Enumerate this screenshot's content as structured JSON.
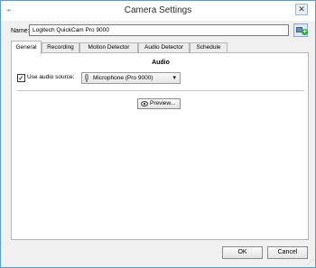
{
  "window": {
    "title": "Camera Settings",
    "close_glyph": "✕",
    "icon": "camera-icon"
  },
  "name_row": {
    "label": "Name:",
    "value": "Logitech QuickCam Pro 9000",
    "action_icon": "add-camera-icon"
  },
  "tabs": [
    {
      "label": "General",
      "active": true
    },
    {
      "label": "Recording",
      "active": false
    },
    {
      "label": "Motion Detector",
      "active": false
    },
    {
      "label": "Audio Detector",
      "active": false
    },
    {
      "label": "Schedule",
      "active": false
    }
  ],
  "audio": {
    "section_title": "Audio",
    "use_audio_label": "Use audio source:",
    "use_audio_checked": true,
    "source_value": "Microphone (Pro 9000)",
    "source_icon": "microphone-icon"
  },
  "preview_button": {
    "label": "Preview..."
  },
  "footer": {
    "ok_label": "OK",
    "cancel_label": "Cancel"
  },
  "colors": {
    "window_border": "#5a9bd5",
    "dialog_bg": "#f0f0f0",
    "accent_green": "#3aa847"
  }
}
